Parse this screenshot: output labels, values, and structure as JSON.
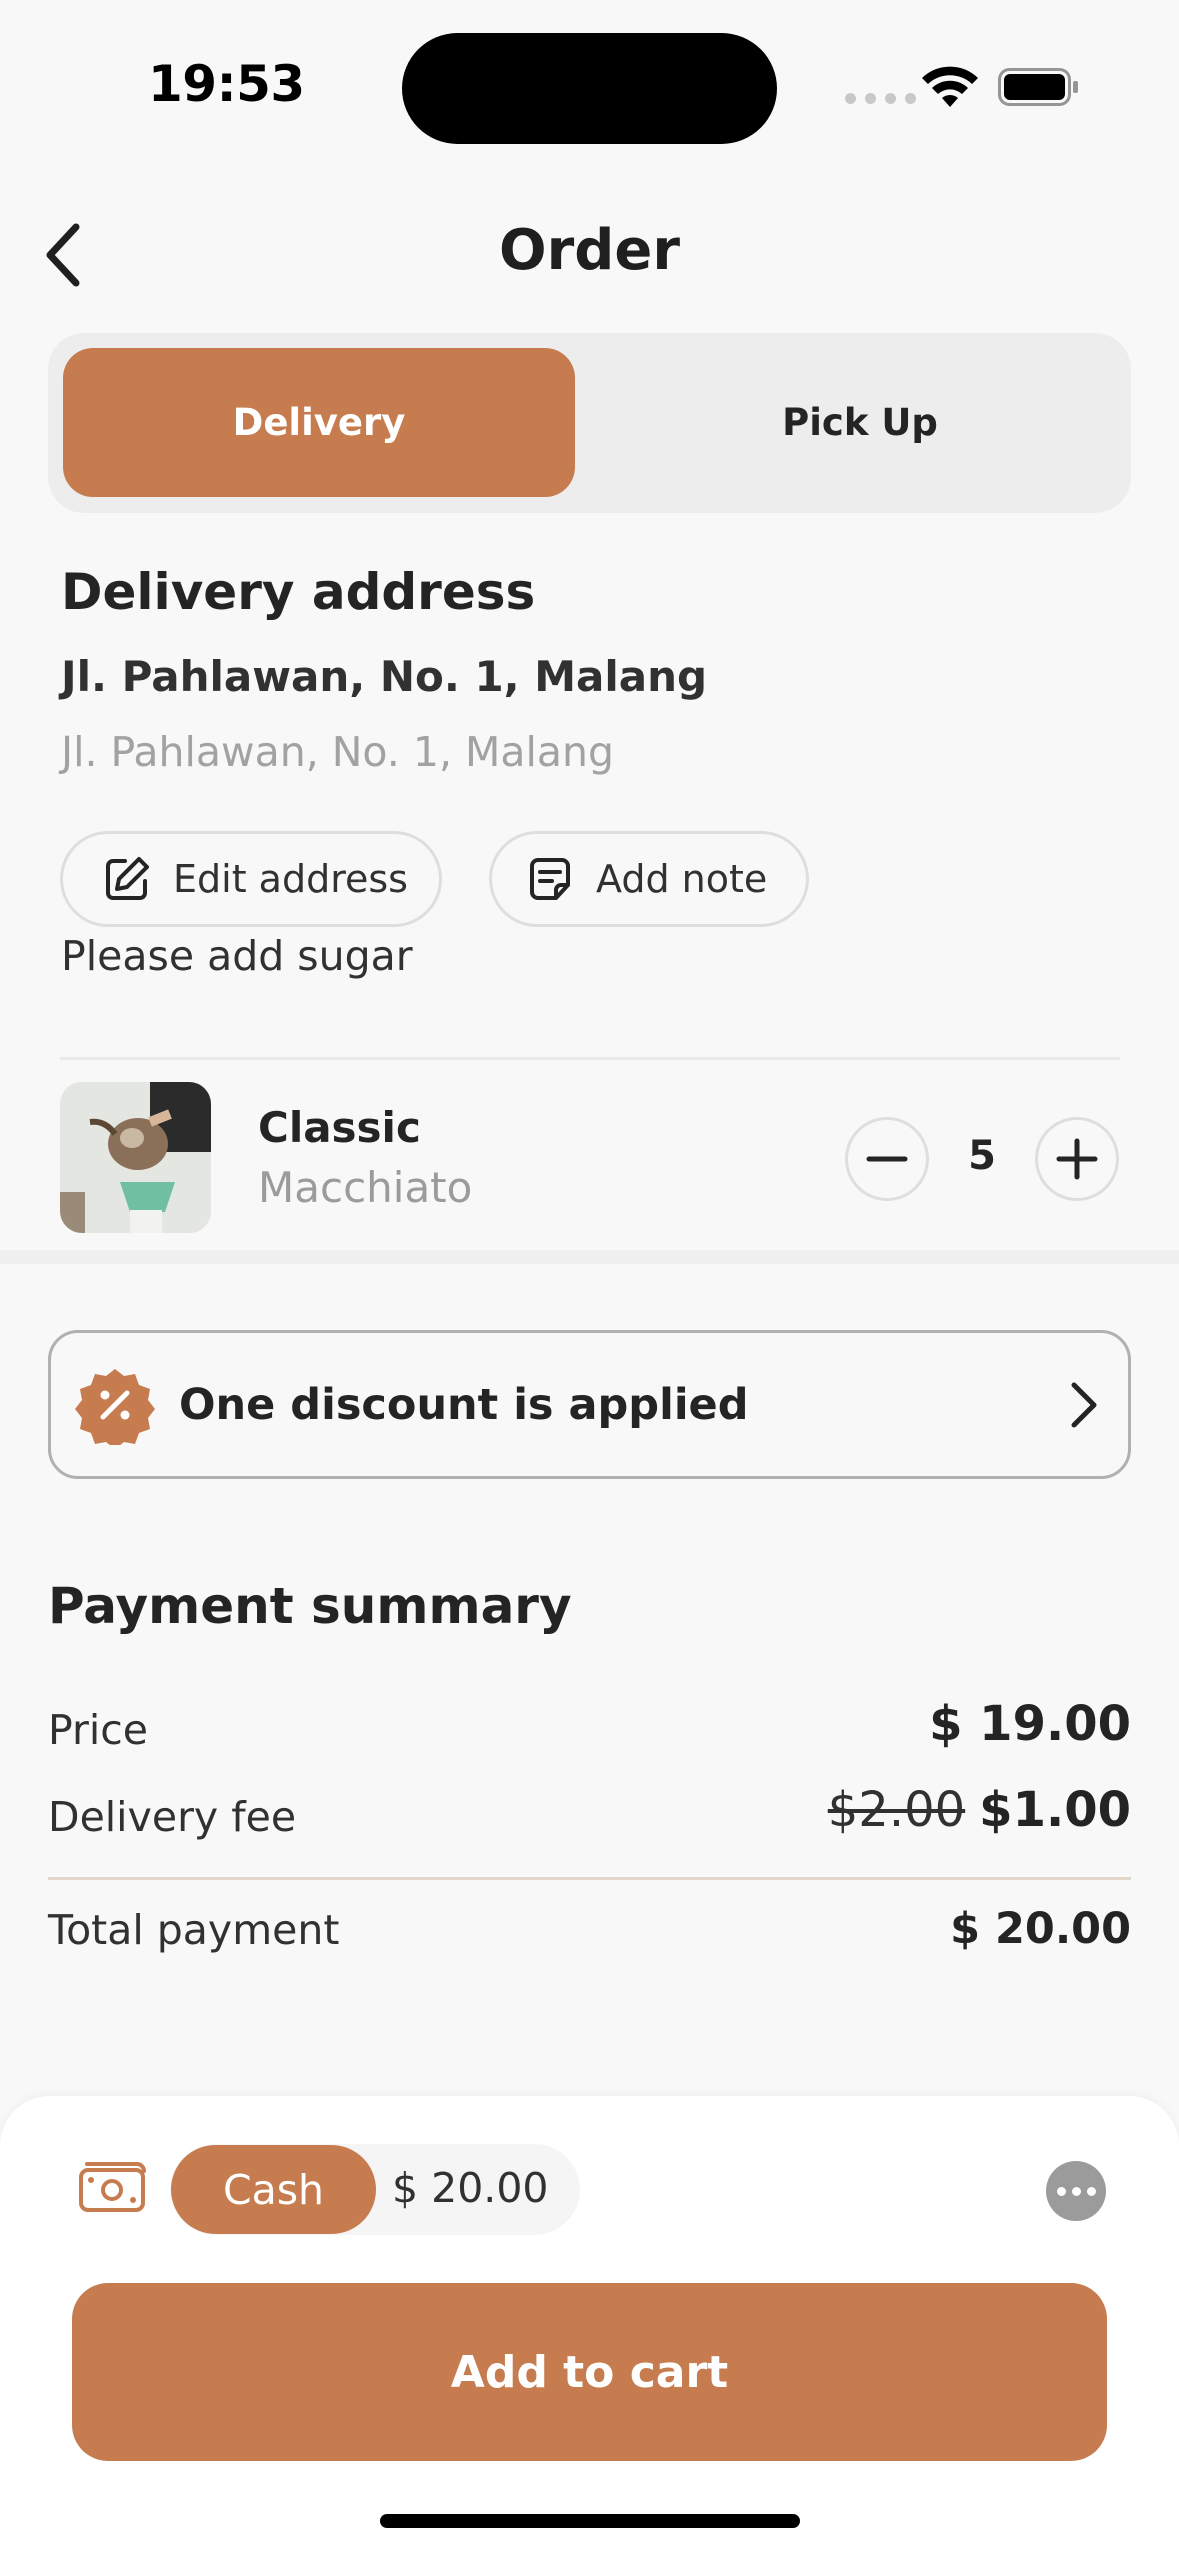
{
  "status_bar": {
    "time": "19:53"
  },
  "header": {
    "title": "Order",
    "back_icon": "chevron-left-icon"
  },
  "segments": {
    "active": "Delivery",
    "inactive": "Pick Up"
  },
  "address": {
    "heading": "Delivery address",
    "main": "Jl. Pahlawan, No. 1, Malang",
    "sub": "Jl. Pahlawan, No. 1, Malang",
    "edit_label": "Edit address",
    "note_label": "Add note",
    "note_text": "Please add sugar"
  },
  "item": {
    "name": "Classic",
    "subtitle": "Macchiato",
    "quantity": "5"
  },
  "discount": {
    "label": "One discount is applied"
  },
  "summary": {
    "heading": "Payment summary",
    "price_label": "Price",
    "price_value": "$ 19.00",
    "fee_label": "Delivery fee",
    "fee_old": "$2.00",
    "fee_new": "$1.00",
    "total_label": "Total payment",
    "total_value": "$ 20.00"
  },
  "payment": {
    "method": "Cash",
    "amount": "$ 20.00",
    "cta": "Add to cart"
  },
  "colors": {
    "accent": "#c67c4e",
    "background": "#f8f8f8",
    "muted_text": "#a2a2a2"
  }
}
